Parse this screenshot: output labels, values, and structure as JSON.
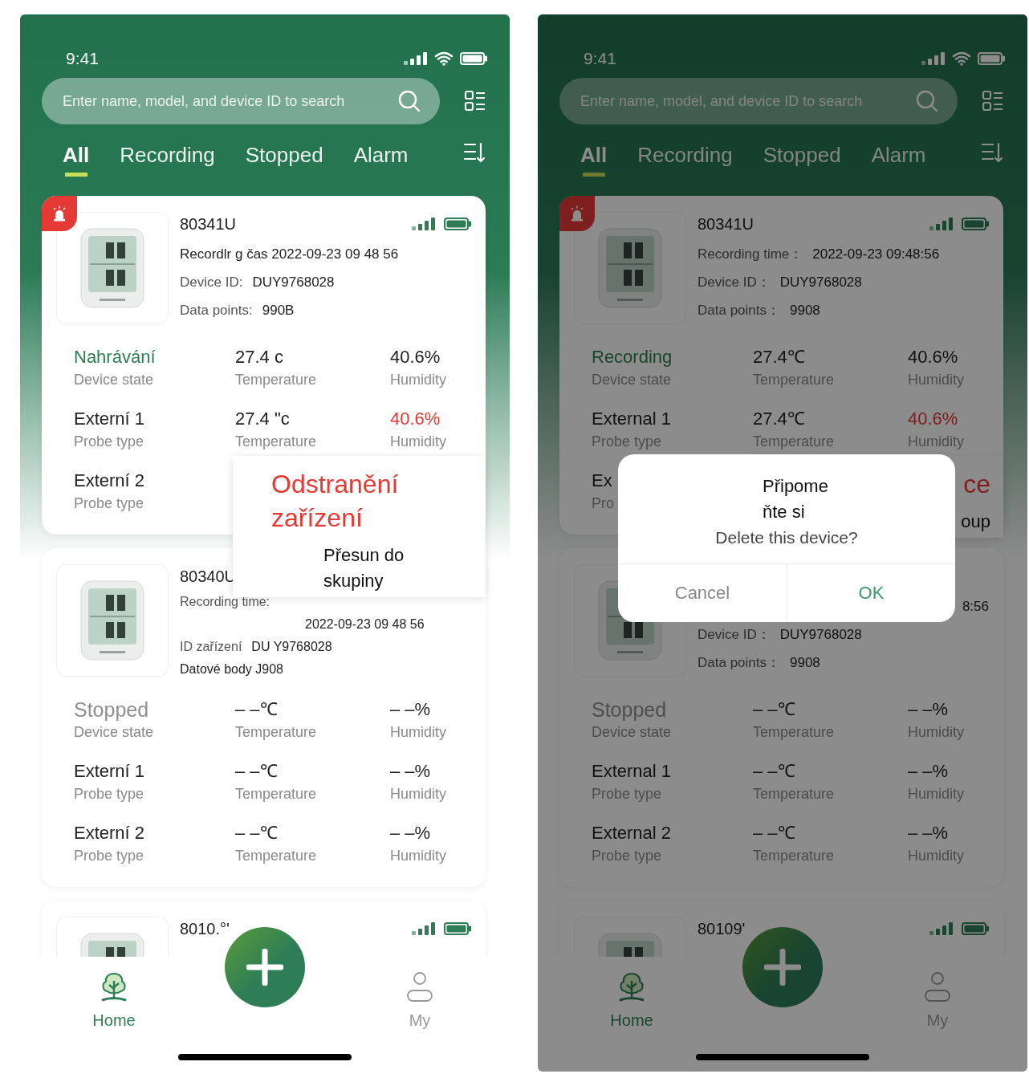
{
  "phones": [
    {
      "status_time": "9:41",
      "search": {
        "placeholder": "Enter name, model, and device ID to search"
      },
      "tabs": [
        {
          "label": "All",
          "selected": true
        },
        {
          "label": "Recording",
          "selected": false
        },
        {
          "label": "Stopped",
          "selected": false
        },
        {
          "label": "Alarm",
          "selected": false
        }
      ],
      "cards": [
        {
          "alarm": true,
          "name": "80341U",
          "indicators": true,
          "lines": [
            {
              "value": "Recordlr g čas 2022-09-23 09 48 56"
            },
            {
              "label": "Device ID:",
              "value": "DUY9768028"
            },
            {
              "label": "Data points:",
              "value": "990B"
            }
          ],
          "rows": [
            [
              {
                "value": "Nahrávání",
                "label": "Device state",
                "kind": "recording"
              },
              {
                "value": "27.4 c",
                "label": "Temperature",
                "kind": "normal"
              },
              {
                "value": "40.6%",
                "label": "Humidity",
                "kind": "normal"
              }
            ],
            [
              {
                "value": "Externí 1",
                "label": "Probe type",
                "kind": "normal"
              },
              {
                "value": "27.4 \"c",
                "label": "Temperature",
                "kind": "normal"
              },
              {
                "value": "40.6%",
                "label": "Humidity",
                "kind": "alarm"
              }
            ],
            [
              {
                "value": "Externí 2",
                "label": "Probe type",
                "kind": "normal"
              }
            ]
          ]
        },
        {
          "alarm": false,
          "name": "80340U",
          "indicators": false,
          "lines": [
            {
              "label": "Recording time:"
            },
            {
              "value": "2022-09-23 09 48 56",
              "kind": "indent"
            },
            {
              "label": "ID zařízení",
              "value": "DU Y9768028"
            },
            {
              "value": "Datové body J908"
            }
          ],
          "rows": [
            [
              {
                "value": "Stopped",
                "label": "Device state",
                "kind": "stopped"
              },
              {
                "value": "– –℃",
                "label": "Temperature",
                "kind": "normal"
              },
              {
                "value": "– –%",
                "label": "Humidity",
                "kind": "normal"
              }
            ],
            [
              {
                "value": "Externí 1",
                "label": "Probe type",
                "kind": "normal"
              },
              {
                "value": "– –℃",
                "label": "Temperature",
                "kind": "normal"
              },
              {
                "value": "– –%",
                "label": "Humidity",
                "kind": "normal"
              }
            ],
            [
              {
                "value": "Externí 2",
                "label": "Probe type",
                "kind": "normal"
              },
              {
                "value": "– –℃",
                "label": "Temperature",
                "kind": "normal"
              },
              {
                "value": "– –%",
                "label": "Humidity",
                "kind": "normal"
              }
            ]
          ]
        },
        {
          "alarm": false,
          "name": "8010.°'",
          "indicators": true
        }
      ],
      "menu": [
        {
          "text": "Odstranění zařízení",
          "kind": "danger"
        },
        {
          "text": "Přesun do skupiny",
          "kind": "normal"
        }
      ],
      "nav": [
        {
          "label": "Home",
          "kind": "home",
          "selected": true
        },
        {
          "label": "My",
          "kind": "profile",
          "selected": false
        }
      ]
    },
    {
      "status_time": "9:41",
      "search": {
        "placeholder": "Enter name, model, and device ID to search"
      },
      "tabs": [
        {
          "label": "All",
          "selected": true
        },
        {
          "label": "Recording",
          "selected": false
        },
        {
          "label": "Stopped",
          "selected": false
        },
        {
          "label": "Alarm",
          "selected": false
        }
      ],
      "cards": [
        {
          "alarm": true,
          "name": "80341U",
          "indicators": true,
          "lines": [
            {
              "label": "Recording time：",
              "value": "2022-09-23 09:48:56"
            },
            {
              "label": "Device ID：",
              "value": "DUY9768028"
            },
            {
              "label": "Data points：",
              "value": "9908"
            }
          ],
          "rows": [
            [
              {
                "value": "Recording",
                "label": "Device state",
                "kind": "recording"
              },
              {
                "value": "27.4℃",
                "label": "Temperature",
                "kind": "normal"
              },
              {
                "value": "40.6%",
                "label": "Humidity",
                "kind": "normal"
              }
            ],
            [
              {
                "value": "External 1",
                "label": "Probe type",
                "kind": "normal"
              },
              {
                "value": "27.4℃",
                "label": "Temperature",
                "kind": "normal"
              },
              {
                "value": "40.6%",
                "label": "Humidity",
                "kind": "alarm"
              }
            ],
            [
              {
                "value": "Ex",
                "label": "Pro",
                "kind": "normal"
              }
            ]
          ]
        },
        {
          "alarm": false,
          "indicators": false,
          "lines": [
            {
              "value": "8:56",
              "kind": "tail"
            },
            {
              "label": "Device ID：",
              "value": "DUY9768028"
            },
            {
              "label": "Data points：",
              "value": "9908"
            }
          ],
          "rows": [
            [
              {
                "value": "Stopped",
                "label": "Device state",
                "kind": "stopped"
              },
              {
                "value": "– –℃",
                "label": "Temperature",
                "kind": "normal"
              },
              {
                "value": "– –%",
                "label": "Humidity",
                "kind": "normal"
              }
            ],
            [
              {
                "value": "External 1",
                "label": "Probe type",
                "kind": "normal"
              },
              {
                "value": "– –℃",
                "label": "Temperature",
                "kind": "normal"
              },
              {
                "value": "– –%",
                "label": "Humidity",
                "kind": "normal"
              }
            ],
            [
              {
                "value": "External 2",
                "label": "Probe type",
                "kind": "normal"
              },
              {
                "value": "– –℃",
                "label": "Temperature",
                "kind": "normal"
              },
              {
                "value": "– –%",
                "label": "Humidity",
                "kind": "normal"
              }
            ]
          ]
        },
        {
          "alarm": false,
          "name": "80109'",
          "indicators": true
        }
      ],
      "menu": [
        {
          "text": "ce",
          "kind": "danger"
        },
        {
          "text": "oup",
          "kind": "normal"
        }
      ],
      "nav": [
        {
          "label": "Home",
          "kind": "home",
          "selected": true
        },
        {
          "label": "My",
          "kind": "profile",
          "selected": false
        }
      ],
      "dialog": {
        "title": "Připome ňte si",
        "message": "Delete this device?",
        "buttons": [
          {
            "label": "Cancel",
            "kind": "cancel"
          },
          {
            "label": "OK",
            "kind": "confirm"
          }
        ]
      }
    }
  ]
}
